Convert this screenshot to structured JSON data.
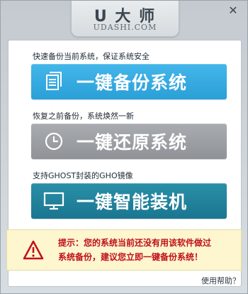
{
  "header": {
    "logo_text": "U 大 师",
    "logo_sub": "UDASHI.COM",
    "close_glyph": "✕"
  },
  "sections": [
    {
      "caption": "快速备份当前系统，保证系统安全",
      "button_label": "一键备份系统",
      "icon": "document-icon",
      "color": "#33a9e0"
    },
    {
      "caption": "恢复之前备份，系统焕然一新",
      "button_label": "一键还原系统",
      "icon": "clock-icon",
      "color": "#9a9ea2"
    },
    {
      "caption": "支持GHOST封装的GHO镜像",
      "button_label": "一键智能装机",
      "icon": "monitor-icon",
      "color": "#1f809b"
    }
  ],
  "notice": {
    "line1": "提示：您的系统当前还没有用该软件做过",
    "line2": "系统备份，建议您立即一键备份系统！",
    "icon": "warning-icon",
    "color": "#c0111a"
  },
  "footer": {
    "help_label": "使用帮助？"
  }
}
